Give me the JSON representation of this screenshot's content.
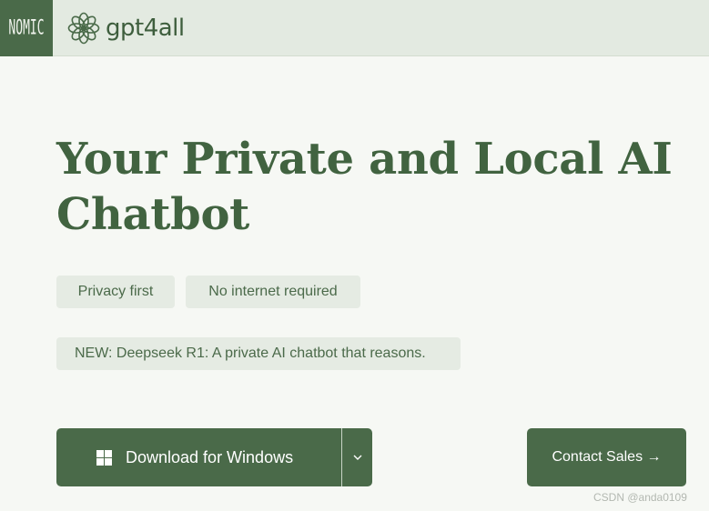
{
  "header": {
    "nomic_label": "NOMIC",
    "brand_name": "gpt4all",
    "brand_icon": "flower-logo-icon"
  },
  "hero": {
    "title": "Your Private and Local AI Chatbot"
  },
  "features": [
    {
      "label": "Privacy first"
    },
    {
      "label": "No internet required"
    }
  ],
  "news": {
    "text": "NEW: Deepseek R1: A private AI chatbot that reasons."
  },
  "actions": {
    "download_label": "Download for Windows",
    "download_icon": "windows-icon",
    "dropdown_icon": "chevron-down-icon",
    "contact_label": "Contact Sales →"
  },
  "watermark": {
    "text": "CSDN @anda0109"
  },
  "colors": {
    "primary": "#4a6a49",
    "title": "#416340",
    "header_bg": "#e3eae1",
    "chip_bg": "#e5ebe3",
    "page_bg": "#f6f8f4"
  }
}
